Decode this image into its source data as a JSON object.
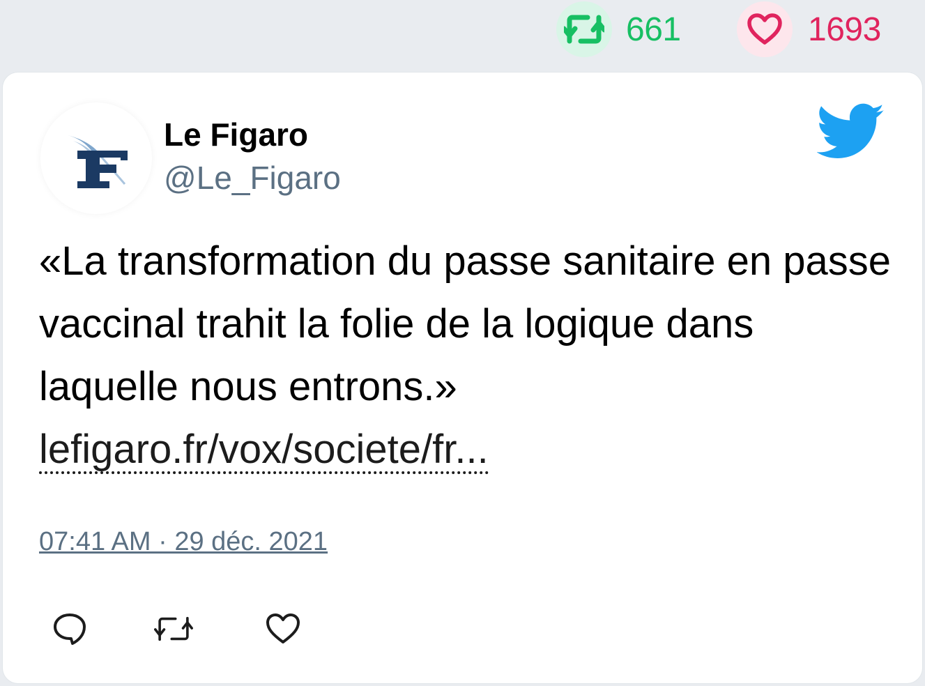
{
  "stats": {
    "retweets": "661",
    "likes": "1693"
  },
  "tweet": {
    "author_name": "Le Figaro",
    "author_handle": "@Le_Figaro",
    "text": "«La transformation du passe sanitaire en passe vaccinal trahit la folie de la logique dans laquelle nous entrons.»",
    "link": "lefigaro.fr/vox/societe/fr...",
    "timestamp": "07:41 AM · 29 déc. 2021"
  },
  "icons": {
    "stats_retweet": "retweet-icon",
    "stats_like": "heart-icon",
    "brand": "twitter-bird-icon",
    "reply": "reply-icon",
    "retweet": "retweet-icon",
    "like": "heart-icon"
  },
  "colors": {
    "retweet_green": "#17bf63",
    "like_pink": "#e0245e",
    "twitter_blue": "#1da1f2",
    "secondary_text": "#5b7083",
    "figaro_navy": "#1b3a63"
  }
}
